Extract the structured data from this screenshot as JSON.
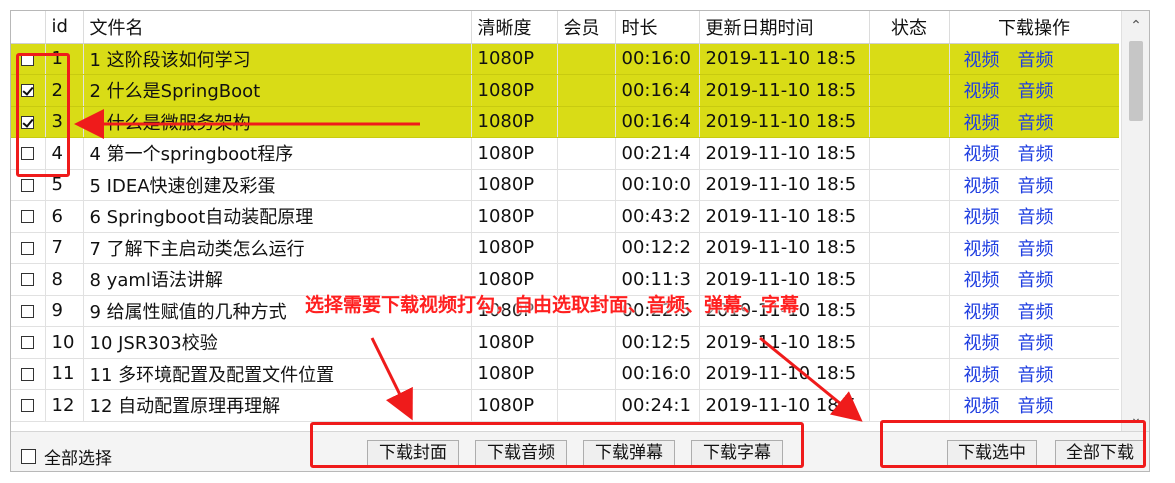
{
  "columns": {
    "id": "id",
    "name": "文件名",
    "resolution": "清晰度",
    "vip": "会员",
    "duration": "时长",
    "updated": "更新日期时间",
    "status": "状态",
    "ops": "下载操作"
  },
  "rows": [
    {
      "checked": false,
      "selected": true,
      "id": "1",
      "name": "1 这阶段该如何学习",
      "res": "1080P",
      "vip": "",
      "dur": "00:16:0",
      "date": "2019-11-10 18:5",
      "status": "",
      "video": "视频",
      "audio": "音频"
    },
    {
      "checked": true,
      "selected": true,
      "id": "2",
      "name": "2 什么是SpringBoot",
      "res": "1080P",
      "vip": "",
      "dur": "00:16:4",
      "date": "2019-11-10 18:5",
      "status": "",
      "video": "视频",
      "audio": "音频"
    },
    {
      "checked": true,
      "selected": true,
      "id": "3",
      "name": "3 什么是微服务架构",
      "res": "1080P",
      "vip": "",
      "dur": "00:16:4",
      "date": "2019-11-10 18:5",
      "status": "",
      "video": "视频",
      "audio": "音频"
    },
    {
      "checked": false,
      "selected": false,
      "id": "4",
      "name": "4 第一个springboot程序",
      "res": "1080P",
      "vip": "",
      "dur": "00:21:4",
      "date": "2019-11-10 18:5",
      "status": "",
      "video": "视频",
      "audio": "音频"
    },
    {
      "checked": false,
      "selected": false,
      "id": "5",
      "name": "5 IDEA快速创建及彩蛋",
      "res": "1080P",
      "vip": "",
      "dur": "00:10:0",
      "date": "2019-11-10 18:5",
      "status": "",
      "video": "视频",
      "audio": "音频"
    },
    {
      "checked": false,
      "selected": false,
      "id": "6",
      "name": "6 Springboot自动装配原理",
      "res": "1080P",
      "vip": "",
      "dur": "00:43:2",
      "date": "2019-11-10 18:5",
      "status": "",
      "video": "视频",
      "audio": "音频"
    },
    {
      "checked": false,
      "selected": false,
      "id": "7",
      "name": "7 了解下主启动类怎么运行",
      "res": "1080P",
      "vip": "",
      "dur": "00:12:2",
      "date": "2019-11-10 18:5",
      "status": "",
      "video": "视频",
      "audio": "音频"
    },
    {
      "checked": false,
      "selected": false,
      "id": "8",
      "name": "8 yaml语法讲解",
      "res": "1080P",
      "vip": "",
      "dur": "00:11:3",
      "date": "2019-11-10 18:5",
      "status": "",
      "video": "视频",
      "audio": "音频"
    },
    {
      "checked": false,
      "selected": false,
      "id": "9",
      "name": "9 给属性赋值的几种方式",
      "res": "1080P",
      "vip": "",
      "dur": "00:22:5",
      "date": "2019-11-10 18:5",
      "status": "",
      "video": "视频",
      "audio": "音频"
    },
    {
      "checked": false,
      "selected": false,
      "id": "10",
      "name": "10 JSR303校验",
      "res": "1080P",
      "vip": "",
      "dur": "00:12:5",
      "date": "2019-11-10 18:5",
      "status": "",
      "video": "视频",
      "audio": "音频"
    },
    {
      "checked": false,
      "selected": false,
      "id": "11",
      "name": "11 多环境配置及配置文件位置",
      "res": "1080P",
      "vip": "",
      "dur": "00:16:0",
      "date": "2019-11-10 18:5",
      "status": "",
      "video": "视频",
      "audio": "音频"
    },
    {
      "checked": false,
      "selected": false,
      "id": "12",
      "name": "12 自动配置原理再理解",
      "res": "1080P",
      "vip": "",
      "dur": "00:24:1",
      "date": "2019-11-10 18:5",
      "status": "",
      "video": "视频",
      "audio": "音频"
    }
  ],
  "footer": {
    "select_all": "全部选择",
    "download_cover": "下载封面",
    "download_audio": "下载音频",
    "download_danmaku": "下载弹幕",
    "download_subtitle": "下载字幕",
    "download_selected": "下载选中",
    "download_all": "全部下载"
  },
  "annotation": "选择需要下载视频打勾，自由选取封面、音频、弹幕、字幕",
  "colors": {
    "selected_row": "#d9dc16",
    "link": "#1f3ee0",
    "annotation_red": "#ef1b1b"
  }
}
